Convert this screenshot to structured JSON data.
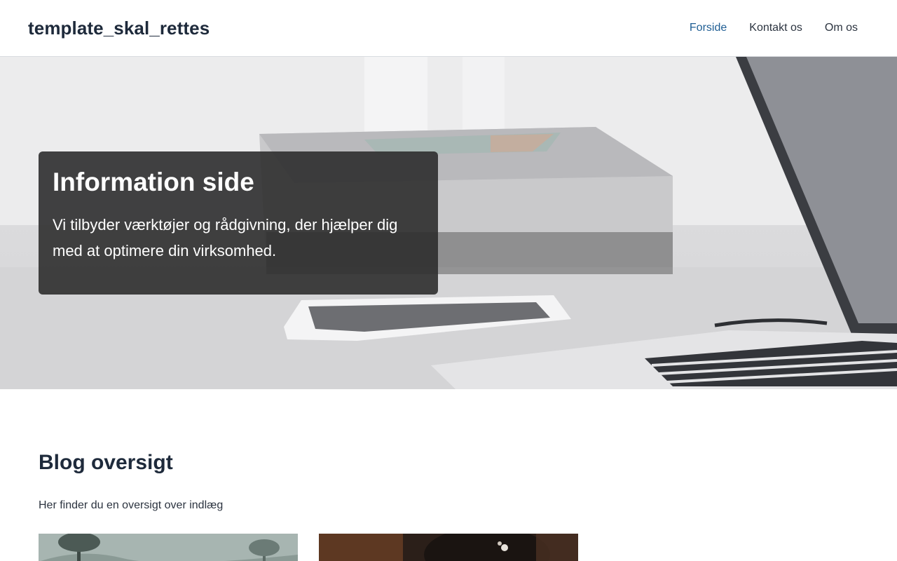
{
  "header": {
    "site_title": "template_skal_rettes",
    "nav": [
      {
        "label": "Forside",
        "active": true
      },
      {
        "label": "Kontakt os",
        "active": false
      },
      {
        "label": "Om os",
        "active": false
      }
    ]
  },
  "hero": {
    "title": "Information side",
    "text": "Vi tilbyder værktøjer og rådgivning, der hjælper dig med at optimere din virksomhed."
  },
  "blog": {
    "title": "Blog oversigt",
    "lead": "Her finder du en oversigt over indlæg",
    "cards": [
      {
        "image": "forest-fog-photo"
      },
      {
        "image": "coffee-cup-photo"
      }
    ]
  },
  "colors": {
    "text_dark": "#1e2a3b",
    "nav_active": "#1f5e94",
    "hero_card_bg": "#2d2d2e"
  }
}
